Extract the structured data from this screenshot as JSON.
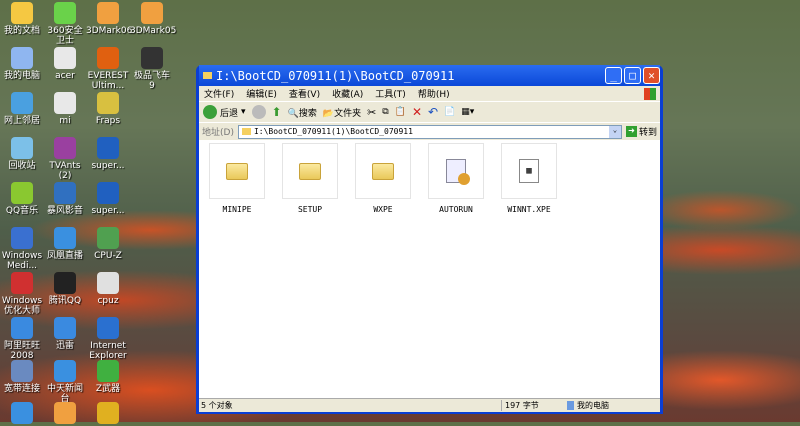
{
  "desktop": {
    "icons": [
      {
        "label": "我的文档",
        "col": 0,
        "row": 0,
        "color": "#f5c842"
      },
      {
        "label": "360安全卫士",
        "col": 1,
        "row": 0,
        "color": "#6ad24a"
      },
      {
        "label": "3DMark06",
        "col": 2,
        "row": 0,
        "color": "#f0a040"
      },
      {
        "label": "3DMark05",
        "col": 3,
        "row": 0,
        "color": "#f0a040"
      },
      {
        "label": "我的电脑",
        "col": 0,
        "row": 1,
        "color": "#8fb6f0"
      },
      {
        "label": "acer",
        "col": 1,
        "row": 1,
        "color": "#e8e8e8"
      },
      {
        "label": "EVEREST Ultim...",
        "col": 2,
        "row": 1,
        "color": "#e06010"
      },
      {
        "label": "极品飞车 9",
        "col": 3,
        "row": 1,
        "color": "#333333"
      },
      {
        "label": "网上邻居",
        "col": 0,
        "row": 2,
        "color": "#4aa0e0"
      },
      {
        "label": "mi",
        "col": 1,
        "row": 2,
        "color": "#e8e8e8"
      },
      {
        "label": "Fraps",
        "col": 2,
        "row": 2,
        "color": "#d8c040"
      },
      {
        "label": "回收站",
        "col": 0,
        "row": 3,
        "color": "#7cc0e8"
      },
      {
        "label": "TVAnts (2)",
        "col": 1,
        "row": 3,
        "color": "#9a40a0"
      },
      {
        "label": "super...",
        "col": 2,
        "row": 3,
        "color": "#2060c0"
      },
      {
        "label": "QQ音乐",
        "col": 0,
        "row": 4,
        "color": "#8ac830"
      },
      {
        "label": "暴风影音",
        "col": 1,
        "row": 4,
        "color": "#3070c0"
      },
      {
        "label": "super...",
        "col": 2,
        "row": 4,
        "color": "#2060c0"
      },
      {
        "label": "Windows Medi...",
        "col": 0,
        "row": 5,
        "color": "#3a70d0"
      },
      {
        "label": "凤凰直播",
        "col": 1,
        "row": 5,
        "color": "#3a90e0"
      },
      {
        "label": "CPU-Z",
        "col": 2,
        "row": 5,
        "color": "#50a050"
      },
      {
        "label": "Windows 优化大师",
        "col": 0,
        "row": 6,
        "color": "#d03030"
      },
      {
        "label": "腾讯QQ",
        "col": 1,
        "row": 6,
        "color": "#222222"
      },
      {
        "label": "cpuz",
        "col": 2,
        "row": 6,
        "color": "#e0e0e0"
      },
      {
        "label": "阿里旺旺 2008",
        "col": 0,
        "row": 7,
        "color": "#3a8ae0"
      },
      {
        "label": "迅雷",
        "col": 1,
        "row": 7,
        "color": "#3a8ae0"
      },
      {
        "label": "Internet Explorer",
        "col": 2,
        "row": 7,
        "color": "#2a70d0"
      },
      {
        "label": "宽带连接",
        "col": 0,
        "row": 8,
        "color": "#6a8ac0"
      },
      {
        "label": "中天新闻台",
        "col": 1,
        "row": 8,
        "color": "#3a90e0"
      },
      {
        "label": "Z武器",
        "col": 2,
        "row": 8,
        "color": "#40b040"
      },
      {
        "label": "",
        "col": 0,
        "row": 9,
        "color": "#3a90e0"
      },
      {
        "label": "",
        "col": 1,
        "row": 9,
        "color": "#f0a040"
      },
      {
        "label": "",
        "col": 2,
        "row": 9,
        "color": "#e0b020"
      }
    ]
  },
  "window": {
    "title": "I:\\BootCD_070911(1)\\BootCD_070911",
    "menu": [
      "文件(F)",
      "编辑(E)",
      "查看(V)",
      "收藏(A)",
      "工具(T)",
      "帮助(H)"
    ],
    "toolbar": {
      "back": "后退",
      "search": "搜索",
      "folders": "文件夹"
    },
    "address": {
      "label": "地址(D)",
      "value": "I:\\BootCD_070911(1)\\BootCD_070911",
      "go": "转到"
    },
    "files": [
      {
        "name": "MINIPE",
        "type": "folder"
      },
      {
        "name": "SETUP",
        "type": "folder"
      },
      {
        "name": "WXPE",
        "type": "folder"
      },
      {
        "name": "AUTORUN",
        "type": "inf"
      },
      {
        "name": "WINNT.XPE",
        "type": "file"
      }
    ],
    "status": {
      "objects": "5 个对象",
      "size": "197 字节",
      "location": "我的电脑"
    }
  }
}
